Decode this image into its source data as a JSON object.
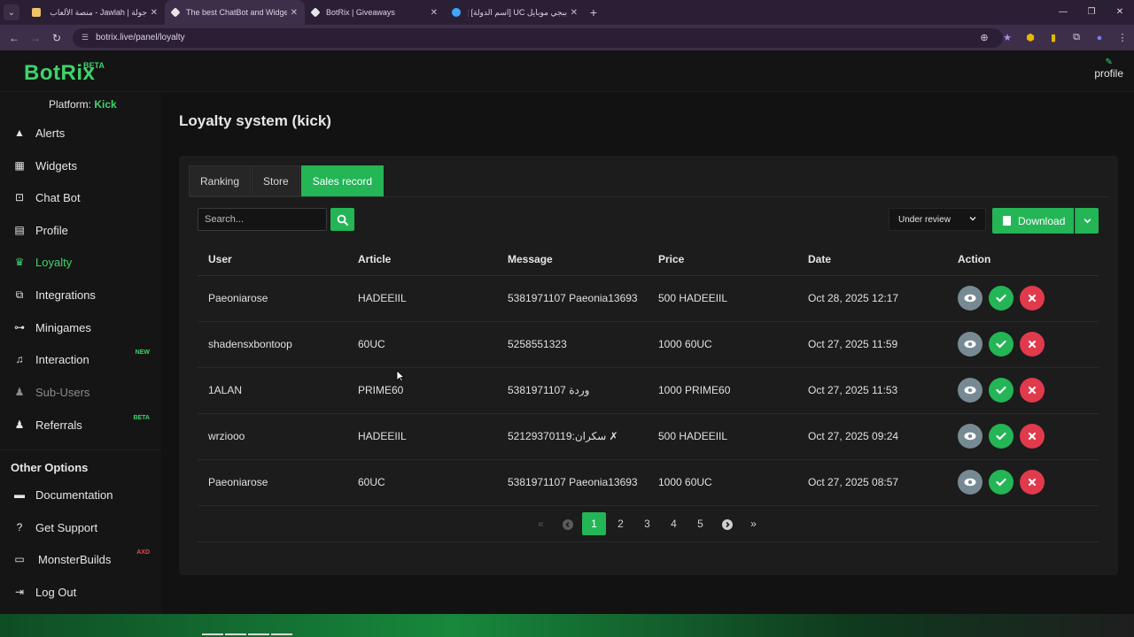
{
  "browser": {
    "tabs": [
      {
        "title": "جولة | Jawlah - منصة الألعاب الـ...",
        "fav_color": "#f0c36a",
        "active": false
      },
      {
        "title": "The best ChatBot and Widgets",
        "fav_color": "#e6e6e6",
        "active": true
      },
      {
        "title": "BotRix | Giveaways",
        "fav_color": "#e6e6e6",
        "active": false
      },
      {
        "title": "ببجي موبايل UC [اسم الدولة] | خـ...",
        "fav_color": "#3ea6ff",
        "active": false
      }
    ],
    "url": "botrix.live/panel/loyalty"
  },
  "header": {
    "logo": "BotRix",
    "logo_badge": "BETA",
    "profile_label": "profile"
  },
  "sidebar": {
    "platform_label": "Platform:",
    "platform_value": "Kick",
    "items": [
      {
        "label": "Alerts",
        "icon": "warning-icon"
      },
      {
        "label": "Widgets",
        "icon": "grid-icon"
      },
      {
        "label": "Chat Bot",
        "icon": "robot-icon"
      },
      {
        "label": "Profile",
        "icon": "id-card-icon"
      },
      {
        "label": "Loyalty",
        "icon": "trophy-icon",
        "active": true
      },
      {
        "label": "Integrations",
        "icon": "integrations-icon"
      },
      {
        "label": "Minigames",
        "icon": "gamepad-icon"
      },
      {
        "label": "Interaction",
        "icon": "music-icon",
        "tag": "NEW"
      },
      {
        "label": "Sub-Users",
        "icon": "users-icon",
        "disabled": true
      },
      {
        "label": "Referrals",
        "icon": "users-icon",
        "tag": "BETA"
      }
    ],
    "other_title": "Other Options",
    "other_items": [
      {
        "label": "Documentation",
        "icon": "book-icon"
      },
      {
        "label": "Get Support",
        "icon": "question-icon"
      },
      {
        "label": "MonsterBuilds",
        "icon": "monitor-icon",
        "tag": "AXD"
      },
      {
        "label": "Log Out",
        "icon": "logout-icon"
      }
    ]
  },
  "main": {
    "title": "Loyalty system (kick)",
    "tabs": [
      "Ranking",
      "Store",
      "Sales record"
    ],
    "active_tab": "Sales record",
    "search_placeholder": "Search...",
    "status_filter": "Under review",
    "download_label": "Download",
    "columns": [
      "User",
      "Article",
      "Message",
      "Price",
      "Date",
      "Action"
    ],
    "rows": [
      {
        "user": "Paeoniarose",
        "article": "HADEEIIL",
        "message": "5381971107 Paeonia13693",
        "price": "500 HADEEIIL",
        "date": "Oct 28, 2025 12:17"
      },
      {
        "user": "shadensxbontoop",
        "article": "60UC",
        "message": "5258551323",
        "price": "1000 60UC",
        "date": "Oct 27, 2025 11:59"
      },
      {
        "user": "1ALAN",
        "article": "PRIME60",
        "message": "5381971107 وردة",
        "price": "1000 PRIME60",
        "date": "Oct 27, 2025 11:53"
      },
      {
        "user": "wrziooo",
        "article": "HADEEIIL",
        "message": "52129370119:سكران ✗",
        "price": "500 HADEEIIL",
        "date": "Oct 27, 2025 09:24"
      },
      {
        "user": "Paeoniarose",
        "article": "60UC",
        "message": "5381971107 Paeonia13693",
        "price": "1000 60UC",
        "date": "Oct 27, 2025 08:57"
      }
    ],
    "pagination": {
      "pages": [
        "1",
        "2",
        "3",
        "4",
        "5"
      ],
      "current": "1"
    }
  },
  "colors": {
    "accent": "#24b556",
    "brand": "#3dd46c",
    "danger": "#e03a4c",
    "muted": "#778a94"
  }
}
